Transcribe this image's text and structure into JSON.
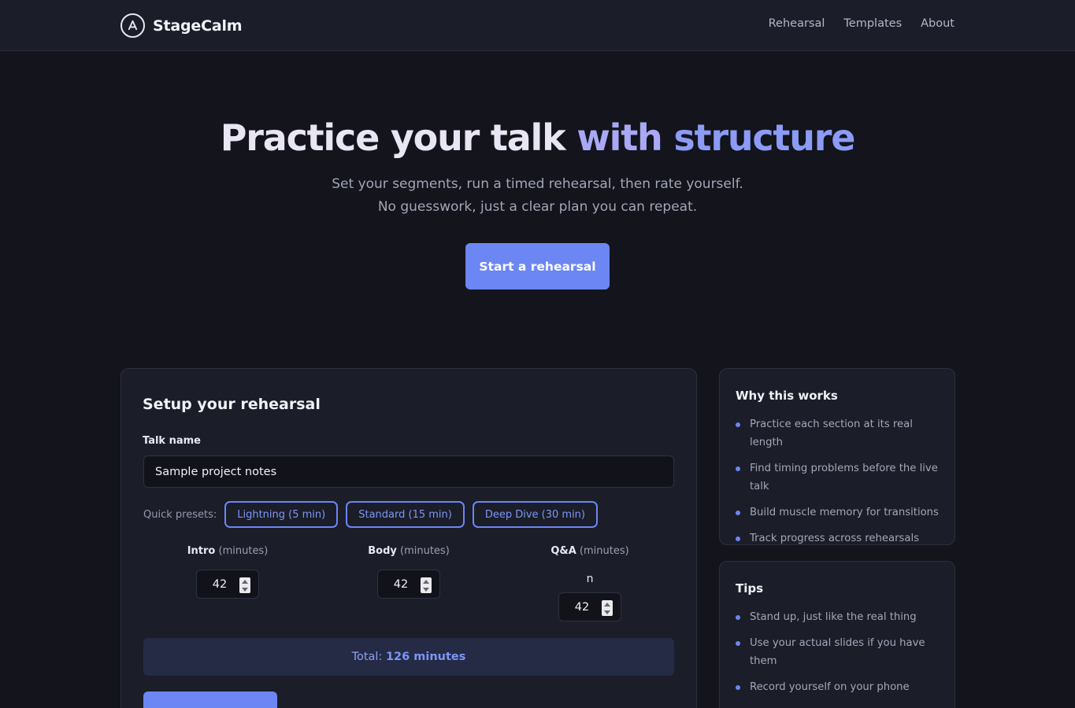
{
  "nav": {
    "brand": "StageCalm",
    "links": [
      "Rehearsal",
      "Templates",
      "About"
    ]
  },
  "hero": {
    "title_parts": [
      "Practice your talk",
      " with",
      " structure"
    ],
    "subtitle": "Set your segments, run a timed rehearsal, then rate yourself. No guesswork, just a clear plan you can repeat.",
    "cta": "Start a rehearsal"
  },
  "setup": {
    "title": "Setup your rehearsal",
    "talk_name_label": "Talk name",
    "talk_name_value": "Sample project notes",
    "presets_label": "Quick presets:",
    "presets": [
      "Lightning (5 min)",
      "Standard (15 min)",
      "Deep Dive (30 min)"
    ],
    "segments": [
      {
        "name": "Intro",
        "unit": "(minutes)",
        "value": "42"
      },
      {
        "name": "Body",
        "unit": "(minutes)",
        "value": "42"
      },
      {
        "name": "Q&A",
        "unit": "(minutes)",
        "value": "42",
        "extra": "n"
      }
    ],
    "total_label": "Total:",
    "total_value": "126 minutes"
  },
  "why": {
    "title": "Why this works",
    "items": [
      "Practice each section at its real length",
      "Find timing problems before the live talk",
      "Build muscle memory for transitions",
      "Track progress across rehearsals"
    ]
  },
  "tips": {
    "title": "Tips",
    "items": [
      "Stand up, just like the real thing",
      "Use your actual slides if you have them",
      "Record yourself on your phone"
    ]
  },
  "colors": {
    "accent": "#6c86f3",
    "background": "#13141c",
    "card": "#1b1d29"
  }
}
